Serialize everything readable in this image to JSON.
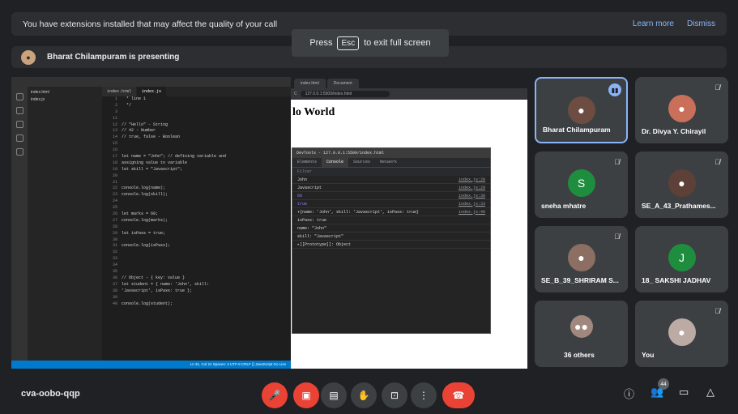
{
  "extension_bar": {
    "message": "You have extensions installed that may affect the quality of your call",
    "learn_more": "Learn more",
    "dismiss": "Dismiss"
  },
  "presenting": {
    "text": "Bharat Chilampuram is presenting"
  },
  "fullscreen_hint": {
    "prefix": "Press",
    "key": "Esc",
    "suffix": "to exit full screen"
  },
  "shared_screen": {
    "editor": {
      "tabs": [
        "index.html",
        "index.js"
      ],
      "code_lines": [
        {
          "n": "1",
          "t": "  * line 1"
        },
        {
          "n": "2",
          "t": "  */"
        },
        {
          "n": "3",
          "t": ""
        },
        {
          "n": "11",
          "t": ""
        },
        {
          "n": "12",
          "t": "// \"Hello\" - String"
        },
        {
          "n": "13",
          "t": "// 42 - Number"
        },
        {
          "n": "14",
          "t": "// true, false - Boolean"
        },
        {
          "n": "15",
          "t": ""
        },
        {
          "n": "16",
          "t": ""
        },
        {
          "n": "17",
          "t": "let name = \"John\"; // defining variable and"
        },
        {
          "n": "18",
          "t": "assigning value to variable"
        },
        {
          "n": "19",
          "t": "let skill = \"Javascript\";"
        },
        {
          "n": "20",
          "t": ""
        },
        {
          "n": "21",
          "t": ""
        },
        {
          "n": "22",
          "t": "console.log(name);"
        },
        {
          "n": "23",
          "t": "console.log(skill);"
        },
        {
          "n": "24",
          "t": ""
        },
        {
          "n": "25",
          "t": ""
        },
        {
          "n": "26",
          "t": "let marks = 60;"
        },
        {
          "n": "27",
          "t": "console.log(marks);"
        },
        {
          "n": "28",
          "t": ""
        },
        {
          "n": "29",
          "t": "let isPass = true;"
        },
        {
          "n": "30",
          "t": ""
        },
        {
          "n": "31",
          "t": "console.log(isPass);"
        },
        {
          "n": "32",
          "t": ""
        },
        {
          "n": "33",
          "t": ""
        },
        {
          "n": "34",
          "t": ""
        },
        {
          "n": "35",
          "t": ""
        },
        {
          "n": "36",
          "t": "// Object - { key: value }"
        },
        {
          "n": "37",
          "t": "let student = { name: 'John', skill:"
        },
        {
          "n": "38",
          "t": "'Javascript', isPass: true };"
        },
        {
          "n": "39",
          "t": ""
        },
        {
          "n": "40",
          "t": "console.log(student);"
        }
      ],
      "status": "Ln 31, Col 21   Spaces: 4   UTF-8   CRLF   {} JavaScript   Go Live"
    },
    "browser": {
      "tabs": [
        "index.html",
        "Document"
      ],
      "url": "127.0.0.1:5500/index.html",
      "heading": "lo World"
    },
    "devtools": {
      "title": "DevTools - 127.0.0.1:5500/index.html",
      "tabs": [
        "Elements",
        "Console",
        "Sources",
        "Network"
      ],
      "filter": "Filter",
      "lines": [
        {
          "v": "John",
          "s": "index.js:28"
        },
        {
          "v": "Javascript",
          "s": "index.js:29"
        },
        {
          "v": "60",
          "s": "index.js:30"
        },
        {
          "v": "true",
          "s": "index.js:33"
        },
        {
          "v": "▾{name: 'John', skill: 'Javascript', isPass: true}",
          "s": "index.js:40"
        },
        {
          "v": "   isPass: true",
          "s": ""
        },
        {
          "v": "   name: \"John\"",
          "s": ""
        },
        {
          "v": "   skill: \"Javascript\"",
          "s": ""
        },
        {
          "v": "  ▸[[Prototype]]: Object",
          "s": ""
        }
      ]
    }
  },
  "participants": [
    {
      "name": "Bharat Chilampuram",
      "initial": "",
      "speaking": true,
      "muted": false
    },
    {
      "name": "Dr. Divya Y. Chirayil",
      "initial": "",
      "speaking": false,
      "muted": true
    },
    {
      "name": "sneha mhatre",
      "initial": "S",
      "speaking": false,
      "muted": true
    },
    {
      "name": "SE_A_43_Prathames...",
      "initial": "",
      "speaking": false,
      "muted": true
    },
    {
      "name": "SE_B_39_SHRIRAM S...",
      "initial": "",
      "speaking": false,
      "muted": true
    },
    {
      "name": "18_ SAKSHI JADHAV",
      "initial": "J",
      "speaking": false,
      "muted": false
    },
    {
      "name": "36 others",
      "initial": "",
      "speaking": false,
      "muted": false
    },
    {
      "name": "You",
      "initial": "",
      "speaking": false,
      "muted": true
    }
  ],
  "bottom_bar": {
    "meeting_code": "cva-oobo-qqp",
    "people_count": "44"
  },
  "colors": {
    "end_call": "#ea4335",
    "accent": "#8ab4f8"
  }
}
